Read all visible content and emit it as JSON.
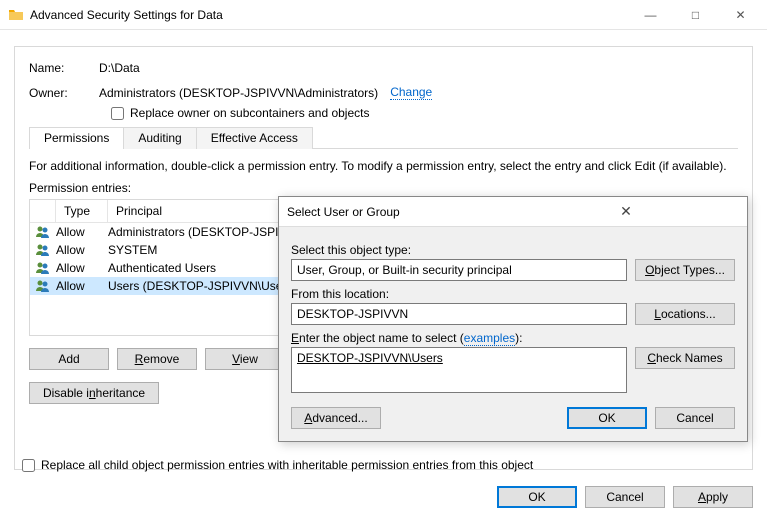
{
  "window": {
    "title": "Advanced Security Settings for Data"
  },
  "main": {
    "name_label": "Name:",
    "name_value": "D:\\Data",
    "owner_label": "Owner:",
    "owner_value": "Administrators (DESKTOP-JSPIVVN\\Administrators)",
    "change_link": "Change",
    "replace_owner": "Replace owner on subcontainers and objects",
    "tabs": [
      "Permissions",
      "Auditing",
      "Effective Access"
    ],
    "hint": "For additional information, double-click a permission entry. To modify a permission entry, select the entry and click Edit (if available).",
    "entries_label": "Permission entries:",
    "headers": {
      "type": "Type",
      "principal": "Principal"
    },
    "rows": [
      {
        "type": "Allow",
        "principal": "Administrators (DESKTOP-JSPI..."
      },
      {
        "type": "Allow",
        "principal": "SYSTEM"
      },
      {
        "type": "Allow",
        "principal": "Authenticated Users"
      },
      {
        "type": "Allow",
        "principal": "Users (DESKTOP-JSPIVVN\\Use..."
      }
    ],
    "add_btn": "Add",
    "remove_btn": "Remove",
    "view_btn": "View",
    "disable_btn": "Disable inheritance",
    "replace_all": "Replace all child object permission entries with inheritable permission entries from this object",
    "ok": "OK",
    "cancel": "Cancel",
    "apply": "Apply"
  },
  "dlg": {
    "title": "Select User or Group",
    "object_type_label": "Select this object type:",
    "object_type_value": "User, Group, or Built-in security principal",
    "object_types_btn": "Object Types...",
    "location_label": "From this location:",
    "location_value": "DESKTOP-JSPIVVN",
    "locations_btn": "Locations...",
    "enter_label": "Enter the object name to select",
    "examples_link": "examples",
    "enter_value": "DESKTOP-JSPIVVN\\Users",
    "check_btn": "Check Names",
    "advanced_btn": "Advanced...",
    "ok": "OK",
    "cancel": "Cancel"
  }
}
